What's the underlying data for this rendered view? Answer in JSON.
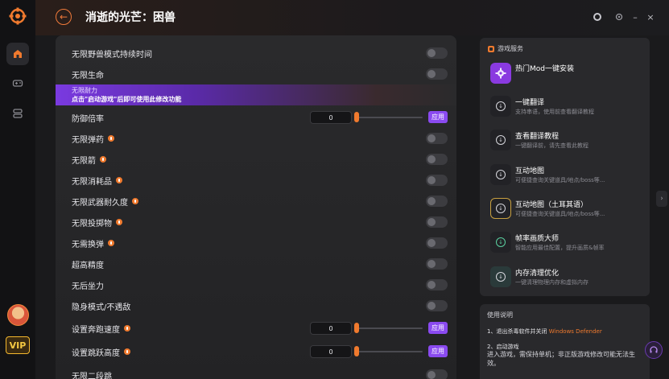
{
  "header": {
    "title": "消逝的光芒：困兽"
  },
  "rail": {
    "vip_label": "VIP"
  },
  "banner": {
    "line1": "无限耐力",
    "line2": "点击\"启动游戏\"后即可使用此修改功能"
  },
  "settings": [
    {
      "label": "无限野兽模式持续时间",
      "type": "toggle",
      "warn": false
    },
    {
      "label": "无限生命",
      "type": "toggle",
      "warn": false
    },
    {
      "label": "防御倍率",
      "type": "slider",
      "warn": false,
      "value": "0",
      "apply": "应用"
    },
    {
      "label": "无限弹药",
      "type": "toggle",
      "warn": true
    },
    {
      "label": "无限箭",
      "type": "toggle",
      "warn": true
    },
    {
      "label": "无限消耗品",
      "type": "toggle",
      "warn": true
    },
    {
      "label": "无限武器耐久度",
      "type": "toggle",
      "warn": true
    },
    {
      "label": "无限投掷物",
      "type": "toggle",
      "warn": true
    },
    {
      "label": "无需换弹",
      "type": "toggle",
      "warn": true
    },
    {
      "label": "超高精度",
      "type": "toggle",
      "warn": false
    },
    {
      "label": "无后坐力",
      "type": "toggle",
      "warn": false
    },
    {
      "label": "隐身模式/不遇敌",
      "type": "toggle",
      "warn": false
    },
    {
      "label": "设置奔跑速度",
      "type": "slider",
      "warn": true,
      "value": "0",
      "apply": "应用"
    },
    {
      "label": "设置跳跃高度",
      "type": "slider",
      "warn": true,
      "value": "0",
      "apply": "应用"
    },
    {
      "label": "无限二段跳",
      "type": "toggle",
      "warn": false
    }
  ],
  "services": {
    "heading": "游戏服务",
    "items": [
      {
        "title": "热门Mod一键安装",
        "subtitle": "",
        "icon": "mod-install-icon"
      },
      {
        "title": "一键翻译",
        "subtitle": "支持串语，使用前查看翻译教程",
        "icon": "download-icon"
      },
      {
        "title": "查看翻译教程",
        "subtitle": "一键翻译前，请先查看此教程",
        "icon": "download-icon"
      },
      {
        "title": "互动地图",
        "subtitle": "可便捷查询关键道具/地点/boss等...",
        "icon": "download-icon"
      },
      {
        "title": "互动地图（土耳其语）",
        "subtitle": "可便捷查询关键道具/地点/boss等...",
        "icon": "download-icon"
      },
      {
        "title": "帧率画质大师",
        "subtitle": "智能应用最佳配置，提升画质&帧率",
        "icon": "download-icon"
      },
      {
        "title": "内存清理优化",
        "subtitle": "一键清理物理内存和虚拟内存",
        "icon": "download-icon"
      }
    ]
  },
  "help": {
    "title": "使用说明",
    "line1_prefix": "1、退出杀毒软件并关闭",
    "line1_highlight": "Windows Defender",
    "line2": "2、启动游戏",
    "line3": "进入游戏，需保持单机；非正版游戏修改可能无法生效。"
  },
  "colors": {
    "accent_orange": "#f07a2e",
    "accent_purple": "#8a4af0",
    "vip_gold": "#f5c842"
  }
}
